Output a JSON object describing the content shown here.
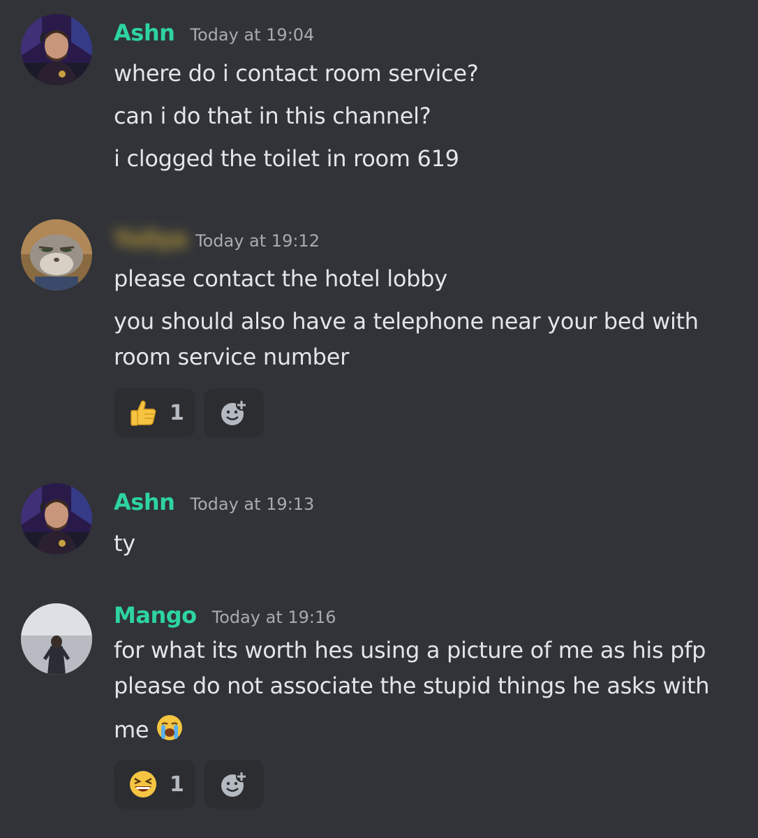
{
  "messages": [
    {
      "username": "Ashn",
      "timestamp": "Today at 19:04",
      "avatar_icon": "user-avatar-ashn",
      "lines": [
        "where do i contact room service?",
        "can i do that in this channel?",
        "i clogged the toilet in room 619"
      ]
    },
    {
      "username": "Yuliya",
      "timestamp": "Today at 19:12",
      "avatar_icon": "user-avatar-bunny",
      "lines": [
        "please contact the hotel lobby",
        "you should also have a telephone near your bed with",
        "room service number"
      ],
      "reaction": {
        "emoji": "thumbs-up-emoji",
        "count": "1"
      }
    },
    {
      "username": "Ashn",
      "timestamp": "Today at 19:13",
      "avatar_icon": "user-avatar-ashn",
      "lines": [
        "ty"
      ]
    },
    {
      "username": "Mango",
      "timestamp": "Today at 19:16",
      "avatar_icon": "user-avatar-mango",
      "lines": [
        "for what its worth hes using a picture of me as his pfp",
        "please do not associate the stupid things he asks with",
        "me"
      ],
      "inline_emoji": "loudly-crying-emoji",
      "reaction": {
        "emoji": "laughing-emoji",
        "count": "1"
      }
    }
  ],
  "add_reaction_icon": "add-reaction-icon",
  "colors": {
    "background": "#313338",
    "username": "#2dd4a0",
    "timestamp": "#a9abb0",
    "text": "#e3e5e8",
    "reaction_bg": "#2b2d31"
  }
}
